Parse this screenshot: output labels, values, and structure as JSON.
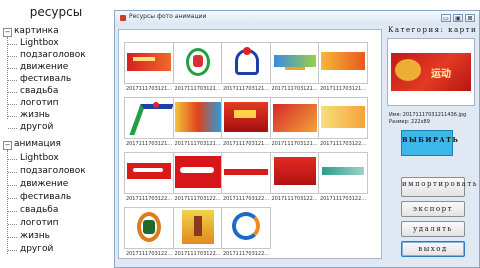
{
  "sidebar": {
    "title": "ресурсы",
    "groups": [
      {
        "label": "картинка",
        "expander": "−",
        "items": [
          "Lightbox",
          "подзаголовок",
          "движение",
          "фестиваль",
          "свадьба",
          "логотип",
          "жизнь",
          "другой"
        ]
      },
      {
        "label": "анимация",
        "expander": "−",
        "items": [
          "Lightbox",
          "подзаголовок",
          "движение",
          "фестиваль",
          "свадьба",
          "логотип",
          "жизнь",
          "другой"
        ]
      }
    ]
  },
  "window": {
    "title": "Ресурсы фото анимации",
    "controls": {
      "minimize": "▭",
      "maximize": "▣",
      "close": "⊠"
    }
  },
  "gallery": {
    "items": [
      {
        "caption": "2017111703121...",
        "art": "red-banner"
      },
      {
        "caption": "2017111703121...",
        "art": "green-logo"
      },
      {
        "caption": "2017111703121...",
        "art": "heart-figure"
      },
      {
        "caption": "2017111703121...",
        "art": "blue-banner"
      },
      {
        "caption": "2017111703121...",
        "art": "orange-banner"
      },
      {
        "caption": "2017111703121...",
        "art": "runner"
      },
      {
        "caption": "2017111703121...",
        "art": "festival-banner"
      },
      {
        "caption": "2017111703121...",
        "art": "red-banner-2"
      },
      {
        "caption": "2017111703121...",
        "art": "sport-banner"
      },
      {
        "caption": "2017111703122...",
        "art": "yellow-banner"
      },
      {
        "caption": "2017111703122...",
        "art": "cola-logo"
      },
      {
        "caption": "2017111703122...",
        "art": "cola-logo-2"
      },
      {
        "caption": "2017111703122...",
        "art": "red-strip"
      },
      {
        "caption": "2017111703122...",
        "art": "red-card"
      },
      {
        "caption": "2017111703122...",
        "art": "teal-banner"
      },
      {
        "caption": "2017111703122...",
        "art": "track-logo"
      },
      {
        "caption": "2017111703122...",
        "art": "athlete"
      },
      {
        "caption": "2017111703122...",
        "art": "circle-logo"
      }
    ]
  },
  "panel": {
    "category_label": "Категория: карти",
    "preview_text": "运动",
    "file_name": "Имя: 20171117031211436.jpg",
    "file_size": "Размер: 222x89",
    "select_label": "ВЫБИРАТЬ",
    "import_label": "импортировать",
    "export_label": "экспорт",
    "delete_label": "удалять",
    "exit_label": "выход"
  },
  "colors": {
    "window_bg": "#dfe8f3",
    "select_button": "#3db6ea",
    "exit_button_border": "#2c78c4"
  }
}
